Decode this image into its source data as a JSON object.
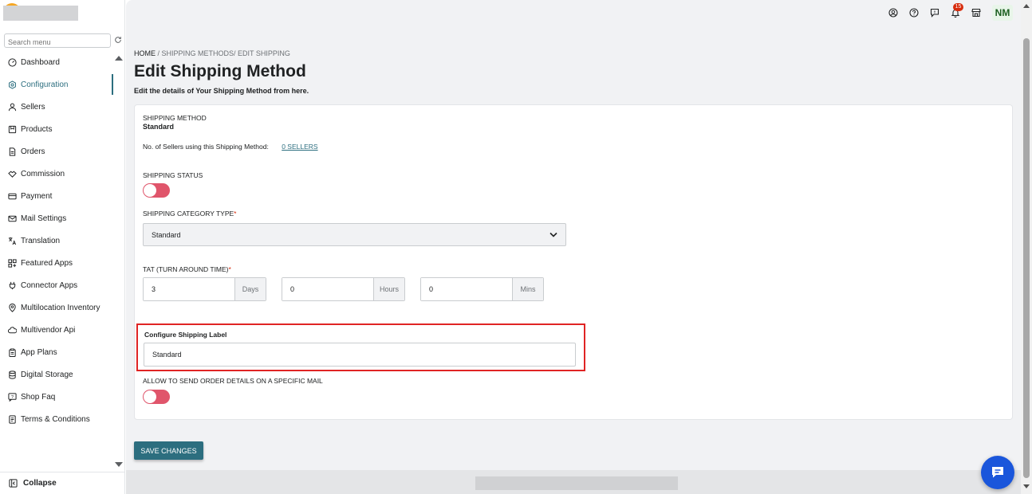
{
  "sidebar": {
    "search_placeholder": "Search menu",
    "items": [
      {
        "label": "Dashboard",
        "icon": "dashboard-icon"
      },
      {
        "label": "Configuration",
        "icon": "gear-icon",
        "active": true
      },
      {
        "label": "Sellers",
        "icon": "user-icon"
      },
      {
        "label": "Products",
        "icon": "product-icon"
      },
      {
        "label": "Orders",
        "icon": "orders-icon"
      },
      {
        "label": "Commission",
        "icon": "handshake-icon"
      },
      {
        "label": "Payment",
        "icon": "payment-icon"
      },
      {
        "label": "Mail Settings",
        "icon": "mail-icon"
      },
      {
        "label": "Translation",
        "icon": "translate-icon"
      },
      {
        "label": "Featured Apps",
        "icon": "apps-icon"
      },
      {
        "label": "Connector Apps",
        "icon": "plug-icon"
      },
      {
        "label": "Multilocation Inventory",
        "icon": "location-icon"
      },
      {
        "label": "Multivendor Api",
        "icon": "cloud-icon"
      },
      {
        "label": "App Plans",
        "icon": "clipboard-icon"
      },
      {
        "label": "Digital Storage",
        "icon": "database-icon"
      },
      {
        "label": "Shop Faq",
        "icon": "faq-icon"
      },
      {
        "label": "Terms & Conditions",
        "icon": "document-icon"
      }
    ],
    "collapse_label": "Collapse"
  },
  "topbar": {
    "notification_count": "15",
    "avatar_initials": "NM"
  },
  "page": {
    "breadcrumb_home": "HOME",
    "breadcrumb_rest": "/ SHIPPING METHODS/ EDIT SHIPPING",
    "title": "Edit Shipping Method",
    "subtitle": "Edit the details of Your Shipping Method from here."
  },
  "form": {
    "shipping_method_label": "SHIPPING METHOD",
    "shipping_method_value": "Standard",
    "sellers_using_label": "No. of Sellers using this Shipping Method:",
    "sellers_link": "0 SELLERS",
    "shipping_status_label": "SHIPPING STATUS",
    "category_type_label": "SHIPPING CATEGORY TYPE",
    "category_type_value": "Standard",
    "tat_label": "TAT (TURN AROUND TIME)",
    "tat_days_value": "3",
    "tat_days_unit": "Days",
    "tat_hours_value": "0",
    "tat_hours_unit": "Hours",
    "tat_mins_value": "0",
    "tat_mins_unit": "Mins",
    "configure_label_title": "Configure Shipping Label",
    "configure_label_value": "Standard",
    "send_order_mail_label": "ALLOW TO SEND ORDER DETAILS ON A SPECIFIC MAIL",
    "required_mark": "*"
  },
  "actions": {
    "save_label": "SAVE CHANGES"
  },
  "colors": {
    "accent": "#2c6e7f",
    "toggle_off": "#e0556b",
    "highlight": "#e02424",
    "chat": "#1a56db"
  }
}
